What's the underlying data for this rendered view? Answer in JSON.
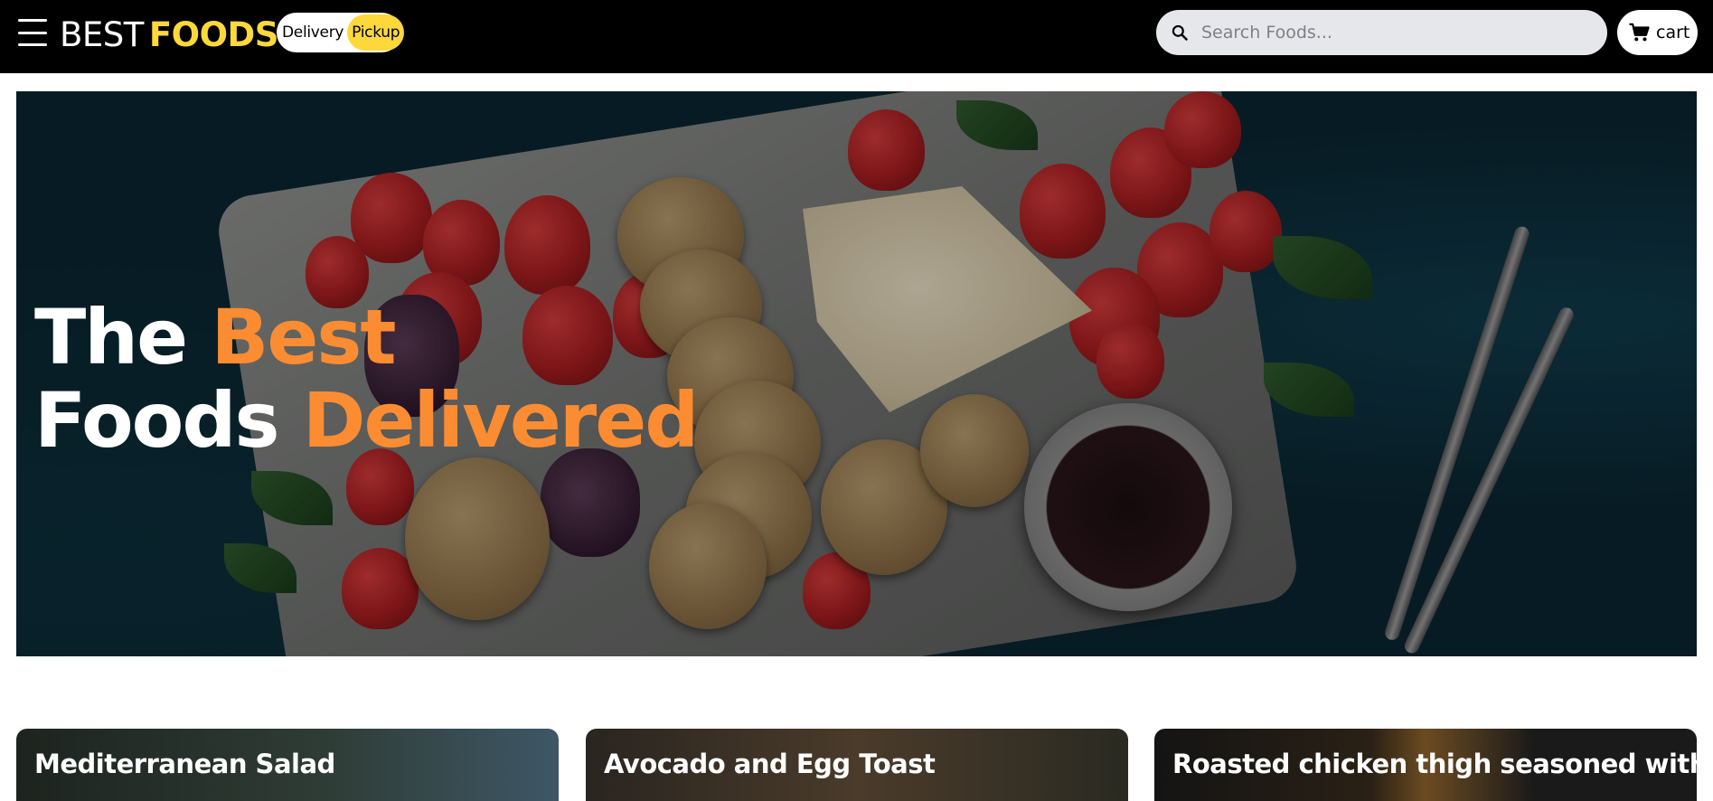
{
  "header": {
    "logo_light": "BEST",
    "logo_bold": "FOODS",
    "mode_toggle": {
      "delivery_label": "Delivery",
      "pickup_label": "Pickup",
      "selected": "Pickup"
    },
    "search": {
      "placeholder": "Search Foods...",
      "value": ""
    },
    "cart_label": "cart"
  },
  "hero": {
    "line1_plain": "The",
    "line1_accent": "Best",
    "line2_plain": "Foods",
    "line2_accent": "Delivered"
  },
  "cards": [
    {
      "title": "Mediterranean Salad"
    },
    {
      "title": "Avocado and Egg Toast"
    },
    {
      "title": "Roasted chicken thigh seasoned with"
    }
  ],
  "colors": {
    "header_bg": "#000000",
    "brand_yellow": "#fcd83b",
    "accent_orange": "#fb8c32",
    "search_bg": "#e6e7ea"
  },
  "icons": [
    "menu-icon",
    "search-icon",
    "cart-icon"
  ]
}
